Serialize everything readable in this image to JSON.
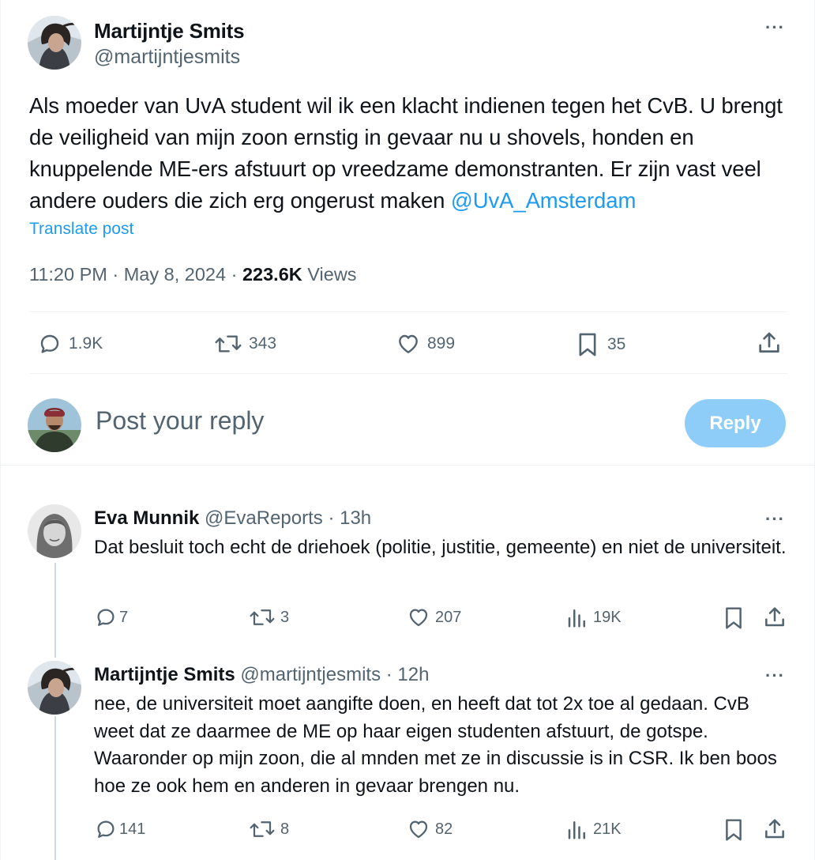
{
  "post": {
    "author_name": "Martijntje Smits",
    "author_handle": "@martijntjesmits",
    "text_main": "Als moeder van UvA student wil ik een klacht indienen tegen het CvB. U brengt de veiligheid van mijn zoon ernstig in gevaar nu u shovels, honden en knuppelende ME-ers afstuurt op vreedzame demonstranten. Er zijn vast veel andere ouders die zich erg ongerust maken ",
    "mention": "@UvA_Amsterdam",
    "translate_label": "Translate post",
    "time": "11:20 PM",
    "sep1": " · ",
    "date": "May 8, 2024",
    "sep2": " · ",
    "views_count": "223.6K",
    "views_label": " Views",
    "replies": "1.9K",
    "reposts": "343",
    "likes": "899",
    "bookmarks": "35",
    "more_label": "···"
  },
  "composer": {
    "placeholder": "Post your reply",
    "reply_button": "Reply"
  },
  "replies": [
    {
      "name": "Eva Munnik",
      "handle_time": " @EvaReports · 13h",
      "text": "Dat besluit toch echt de driehoek (politie, justitie, gemeente) en niet de universiteit.",
      "replies": "7",
      "reposts": "3",
      "likes": "207",
      "views": "19K"
    },
    {
      "name": "Martijntje Smits",
      "handle_time": " @martijntjesmits · 12h",
      "text": "nee, de universiteit moet aangifte doen, en heeft dat tot 2x toe al gedaan. CvB weet dat ze daarmee de ME op haar eigen studenten afstuurt, de gotspe. Waaronder op mijn zoon, die al mnden met ze in discussie is in CSR. Ik ben boos hoe ze ook hem en anderen in gevaar brengen nu.",
      "replies": "141",
      "reposts": "8",
      "likes": "82",
      "views": "21K"
    }
  ],
  "colors": {
    "accent": "#1d9bf0",
    "reply_button_disabled": "#8ecdf8",
    "secondary_text": "#536471",
    "primary_text": "#0f1419",
    "divider": "#eff3f4"
  }
}
